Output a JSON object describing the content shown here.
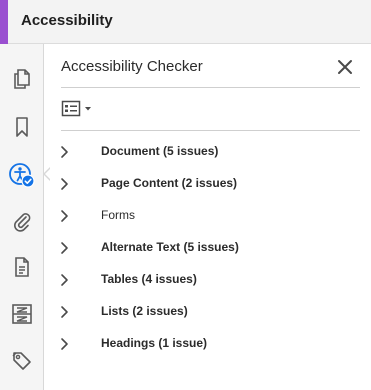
{
  "titlebar": {
    "title": "Accessibility",
    "accent_color": "#9a4fd0"
  },
  "rail": {
    "items": [
      {
        "name": "pages-icon"
      },
      {
        "name": "bookmark-icon"
      },
      {
        "name": "accessibility-checker-icon",
        "active": true,
        "accent": "#1473e6"
      },
      {
        "name": "attachment-icon"
      },
      {
        "name": "content-icon"
      },
      {
        "name": "order-icon"
      },
      {
        "name": "tags-icon"
      }
    ]
  },
  "panel": {
    "title": "Accessibility Checker",
    "close_icon": "close-icon",
    "options_icon": "options-menu-icon",
    "items": [
      {
        "label": "Document (5 issues)",
        "bold": true
      },
      {
        "label": "Page Content (2 issues)",
        "bold": true
      },
      {
        "label": "Forms",
        "bold": false
      },
      {
        "label": "Alternate Text (5 issues)",
        "bold": true
      },
      {
        "label": "Tables (4 issues)",
        "bold": true
      },
      {
        "label": "Lists (2 issues)",
        "bold": true
      },
      {
        "label": "Headings (1 issue)",
        "bold": true
      }
    ]
  }
}
